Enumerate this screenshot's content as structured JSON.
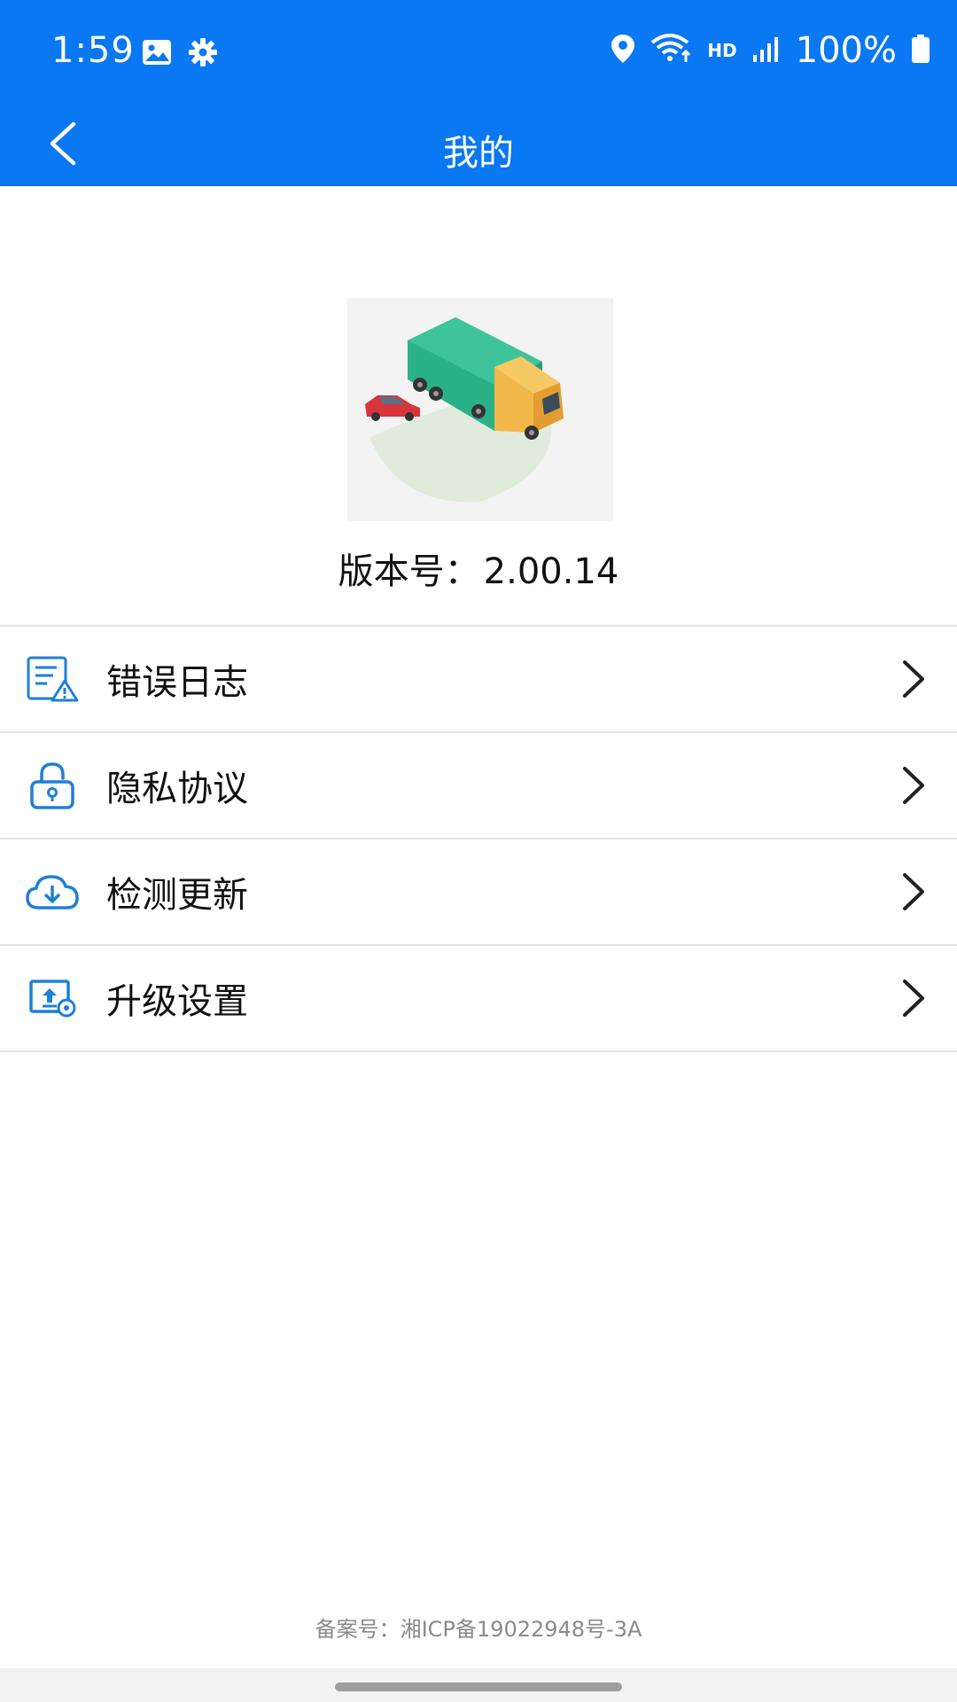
{
  "status_bar": {
    "time": "1:59",
    "battery_text": "100%",
    "network_label": "HD",
    "icons": [
      "image-icon",
      "gear-icon",
      "location-icon",
      "wifi-icon",
      "signal-icon",
      "battery-icon"
    ]
  },
  "app_bar": {
    "title": "我的",
    "back_icon": "chevron-left-icon"
  },
  "logo": {
    "description_icon": "truck-car-illustration"
  },
  "version": {
    "label": "版本号：",
    "value": "2.00.14"
  },
  "menu": {
    "items": [
      {
        "label": "错误日志",
        "icon": "error-log-icon"
      },
      {
        "label": "隐私协议",
        "icon": "lock-icon"
      },
      {
        "label": "检测更新",
        "icon": "cloud-download-icon"
      },
      {
        "label": "升级设置",
        "icon": "upgrade-settings-icon"
      }
    ]
  },
  "footer": {
    "text": "备案号：湘ICP备19022948号-3A"
  },
  "colors": {
    "primary": "#0a78f2",
    "icon_blue": "#1e7fd6",
    "divider": "#e6e6e6",
    "footer_text": "#8a8a8a"
  }
}
